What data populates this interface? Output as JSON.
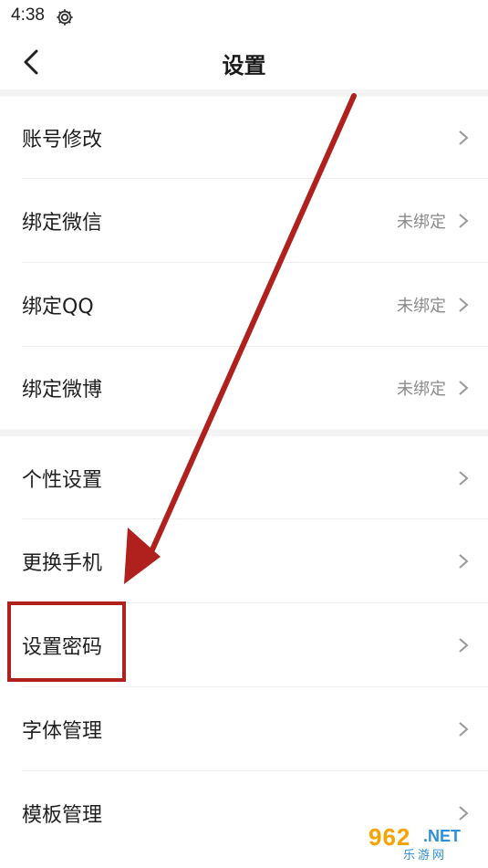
{
  "status_bar": {
    "time": "4:38",
    "icon": "gear-icon"
  },
  "nav": {
    "title": "设置",
    "back_icon": "chevron-left-icon"
  },
  "groups": [
    {
      "items": [
        {
          "label": "账号修改",
          "value": ""
        },
        {
          "label": "绑定微信",
          "value": "未绑定"
        },
        {
          "label": "绑定QQ",
          "value": "未绑定"
        },
        {
          "label": "绑定微博",
          "value": "未绑定"
        }
      ]
    },
    {
      "items": [
        {
          "label": "个性设置",
          "value": ""
        },
        {
          "label": "更换手机",
          "value": ""
        },
        {
          "label": "设置密码",
          "value": ""
        },
        {
          "label": "字体管理",
          "value": ""
        },
        {
          "label": "模板管理",
          "value": ""
        }
      ]
    }
  ],
  "annotation": {
    "color": "#b0201c",
    "highlighted_item": "设置密码"
  },
  "watermark": {
    "number": "962",
    "domain": ".NET",
    "sub": "乐游网"
  }
}
